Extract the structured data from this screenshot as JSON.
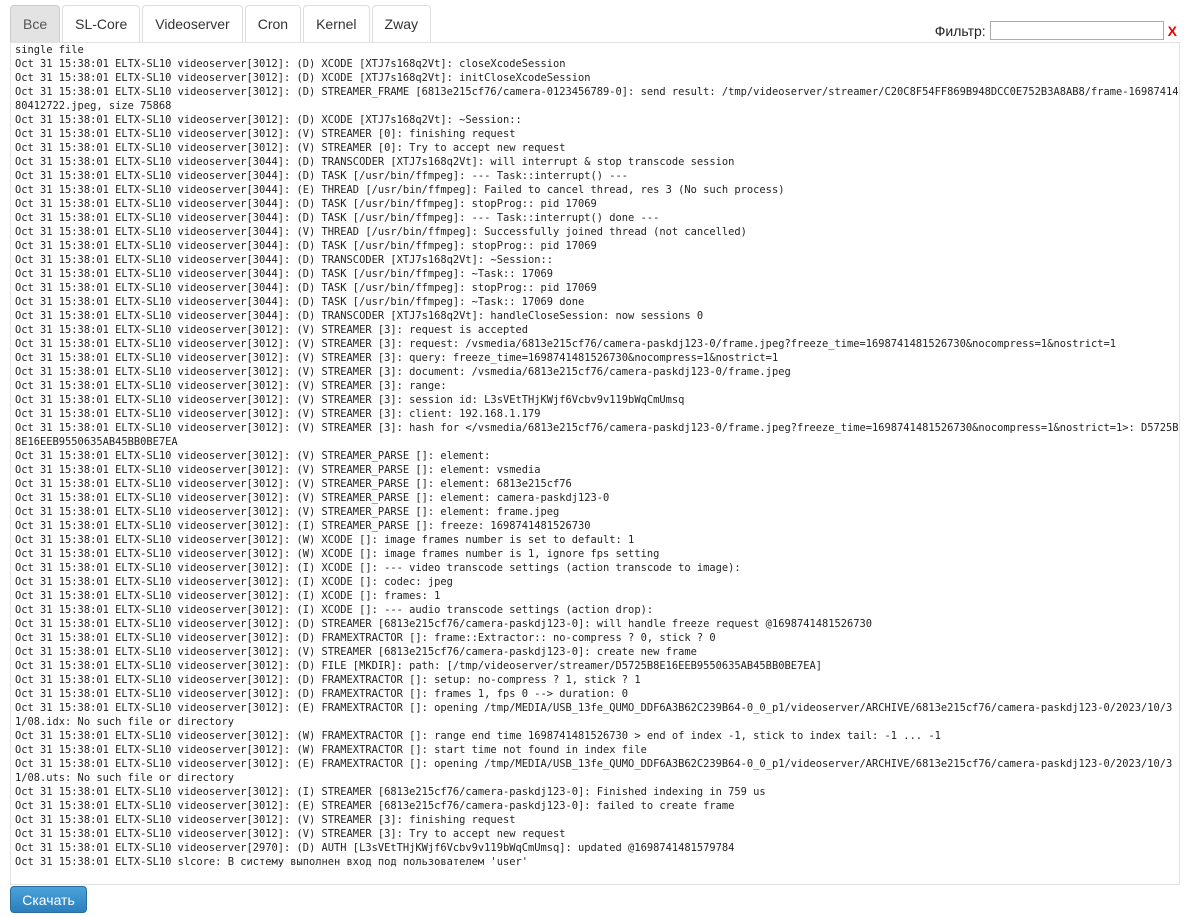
{
  "tabs": [
    {
      "label": "Все",
      "active": true
    },
    {
      "label": "SL-Core",
      "active": false
    },
    {
      "label": "Videoserver",
      "active": false
    },
    {
      "label": "Cron",
      "active": false
    },
    {
      "label": "Kernel",
      "active": false
    },
    {
      "label": "Zway",
      "active": false
    }
  ],
  "filter": {
    "label": "Фильтр:",
    "value": "",
    "clear_label": "X",
    "clear_color": "#ee0000"
  },
  "log": {
    "lines": [
      "single file",
      "Oct 31 15:38:01 ELTX-SL10 videoserver[3012]: (D) XCODE [XTJ7s168q2Vt]: closeXcodeSession",
      "Oct 31 15:38:01 ELTX-SL10 videoserver[3012]: (D) XCODE [XTJ7s168q2Vt]: initCloseXcodeSession",
      "Oct 31 15:38:01 ELTX-SL10 videoserver[3012]: (D) STREAMER_FRAME [6813e215cf76/camera-0123456789-0]: send result: /tmp/videoserver/streamer/C20C8F54FF869B948DCC0E752B3A8AB8/frame-1698741480412722.jpeg, size 75868",
      "Oct 31 15:38:01 ELTX-SL10 videoserver[3012]: (D) XCODE [XTJ7s168q2Vt]: ~Session::",
      "Oct 31 15:38:01 ELTX-SL10 videoserver[3012]: (V) STREAMER [0]: finishing request",
      "Oct 31 15:38:01 ELTX-SL10 videoserver[3012]: (V) STREAMER [0]: Try to accept new request",
      "Oct 31 15:38:01 ELTX-SL10 videoserver[3044]: (D) TRANSCODER [XTJ7s168q2Vt]: will interrupt & stop transcode session",
      "Oct 31 15:38:01 ELTX-SL10 videoserver[3044]: (D) TASK [/usr/bin/ffmpeg]: --- Task::interrupt() ---",
      "Oct 31 15:38:01 ELTX-SL10 videoserver[3044]: (E) THREAD [/usr/bin/ffmpeg]: Failed to cancel thread, res 3 (No such process)",
      "Oct 31 15:38:01 ELTX-SL10 videoserver[3044]: (D) TASK [/usr/bin/ffmpeg]: stopProg:: pid 17069",
      "Oct 31 15:38:01 ELTX-SL10 videoserver[3044]: (D) TASK [/usr/bin/ffmpeg]: --- Task::interrupt() done ---",
      "Oct 31 15:38:01 ELTX-SL10 videoserver[3044]: (V) THREAD [/usr/bin/ffmpeg]: Successfully joined thread (not cancelled)",
      "Oct 31 15:38:01 ELTX-SL10 videoserver[3044]: (D) TASK [/usr/bin/ffmpeg]: stopProg:: pid 17069",
      "Oct 31 15:38:01 ELTX-SL10 videoserver[3044]: (D) TRANSCODER [XTJ7s168q2Vt]: ~Session::",
      "Oct 31 15:38:01 ELTX-SL10 videoserver[3044]: (D) TASK [/usr/bin/ffmpeg]: ~Task:: 17069",
      "Oct 31 15:38:01 ELTX-SL10 videoserver[3044]: (D) TASK [/usr/bin/ffmpeg]: stopProg:: pid 17069",
      "Oct 31 15:38:01 ELTX-SL10 videoserver[3044]: (D) TASK [/usr/bin/ffmpeg]: ~Task:: 17069 done",
      "Oct 31 15:38:01 ELTX-SL10 videoserver[3044]: (D) TRANSCODER [XTJ7s168q2Vt]: handleCloseSession: now sessions 0",
      "Oct 31 15:38:01 ELTX-SL10 videoserver[3012]: (V) STREAMER [3]: request is accepted",
      "Oct 31 15:38:01 ELTX-SL10 videoserver[3012]: (V) STREAMER [3]: request: /vsmedia/6813e215cf76/camera-paskdj123-0/frame.jpeg?freeze_time=1698741481526730&nocompress=1&nostrict=1",
      "Oct 31 15:38:01 ELTX-SL10 videoserver[3012]: (V) STREAMER [3]: query: freeze_time=1698741481526730&nocompress=1&nostrict=1",
      "Oct 31 15:38:01 ELTX-SL10 videoserver[3012]: (V) STREAMER [3]: document: /vsmedia/6813e215cf76/camera-paskdj123-0/frame.jpeg",
      "Oct 31 15:38:01 ELTX-SL10 videoserver[3012]: (V) STREAMER [3]: range:",
      "Oct 31 15:38:01 ELTX-SL10 videoserver[3012]: (V) STREAMER [3]: session id: L3sVEtTHjKWjf6Vcbv9v119bWqCmUmsq",
      "Oct 31 15:38:01 ELTX-SL10 videoserver[3012]: (V) STREAMER [3]: client: 192.168.1.179",
      "Oct 31 15:38:01 ELTX-SL10 videoserver[3012]: (V) STREAMER [3]: hash for </vsmedia/6813e215cf76/camera-paskdj123-0/frame.jpeg?freeze_time=1698741481526730&nocompress=1&nostrict=1>: D5725B8E16EEB9550635AB45BB0BE7EA",
      "Oct 31 15:38:01 ELTX-SL10 videoserver[3012]: (V) STREAMER_PARSE []: element:",
      "Oct 31 15:38:01 ELTX-SL10 videoserver[3012]: (V) STREAMER_PARSE []: element: vsmedia",
      "Oct 31 15:38:01 ELTX-SL10 videoserver[3012]: (V) STREAMER_PARSE []: element: 6813e215cf76",
      "Oct 31 15:38:01 ELTX-SL10 videoserver[3012]: (V) STREAMER_PARSE []: element: camera-paskdj123-0",
      "Oct 31 15:38:01 ELTX-SL10 videoserver[3012]: (V) STREAMER_PARSE []: element: frame.jpeg",
      "Oct 31 15:38:01 ELTX-SL10 videoserver[3012]: (I) STREAMER_PARSE []: freeze: 1698741481526730",
      "Oct 31 15:38:01 ELTX-SL10 videoserver[3012]: (W) XCODE []: image frames number is set to default: 1",
      "Oct 31 15:38:01 ELTX-SL10 videoserver[3012]: (W) XCODE []: image frames number is 1, ignore fps setting",
      "Oct 31 15:38:01 ELTX-SL10 videoserver[3012]: (I) XCODE []: --- video transcode settings (action transcode to image):",
      "Oct 31 15:38:01 ELTX-SL10 videoserver[3012]: (I) XCODE []: codec: jpeg",
      "Oct 31 15:38:01 ELTX-SL10 videoserver[3012]: (I) XCODE []: frames: 1",
      "Oct 31 15:38:01 ELTX-SL10 videoserver[3012]: (I) XCODE []: --- audio transcode settings (action drop):",
      "Oct 31 15:38:01 ELTX-SL10 videoserver[3012]: (D) STREAMER [6813e215cf76/camera-paskdj123-0]: will handle freeze request @1698741481526730",
      "Oct 31 15:38:01 ELTX-SL10 videoserver[3012]: (D) FRAMEXTRACTOR []: frame::Extractor:: no-compress ? 0, stick ? 0",
      "Oct 31 15:38:01 ELTX-SL10 videoserver[3012]: (V) STREAMER [6813e215cf76/camera-paskdj123-0]: create new frame",
      "Oct 31 15:38:01 ELTX-SL10 videoserver[3012]: (D) FILE [MKDIR]: path: [/tmp/videoserver/streamer/D5725B8E16EEB9550635AB45BB0BE7EA]",
      "Oct 31 15:38:01 ELTX-SL10 videoserver[3012]: (D) FRAMEXTRACTOR []: setup: no-compress ? 1, stick ? 1",
      "Oct 31 15:38:01 ELTX-SL10 videoserver[3012]: (D) FRAMEXTRACTOR []: frames 1, fps 0 --> duration: 0",
      "Oct 31 15:38:01 ELTX-SL10 videoserver[3012]: (E) FRAMEXTRACTOR []: opening /tmp/MEDIA/USB_13fe_QUMO_DDF6A3B62C239B64-0_0_p1/videoserver/ARCHIVE/6813e215cf76/camera-paskdj123-0/2023/10/31/08.idx: No such file or directory",
      "Oct 31 15:38:01 ELTX-SL10 videoserver[3012]: (W) FRAMEXTRACTOR []: range end time 1698741481526730 > end of index -1, stick to index tail: -1 ... -1",
      "Oct 31 15:38:01 ELTX-SL10 videoserver[3012]: (W) FRAMEXTRACTOR []: start time not found in index file",
      "Oct 31 15:38:01 ELTX-SL10 videoserver[3012]: (E) FRAMEXTRACTOR []: opening /tmp/MEDIA/USB_13fe_QUMO_DDF6A3B62C239B64-0_0_p1/videoserver/ARCHIVE/6813e215cf76/camera-paskdj123-0/2023/10/31/08.uts: No such file or directory",
      "Oct 31 15:38:01 ELTX-SL10 videoserver[3012]: (I) STREAMER [6813e215cf76/camera-paskdj123-0]: Finished indexing in 759 us",
      "Oct 31 15:38:01 ELTX-SL10 videoserver[3012]: (E) STREAMER [6813e215cf76/camera-paskdj123-0]: failed to create frame",
      "Oct 31 15:38:01 ELTX-SL10 videoserver[3012]: (V) STREAMER [3]: finishing request",
      "Oct 31 15:38:01 ELTX-SL10 videoserver[3012]: (V) STREAMER [3]: Try to accept new request",
      "Oct 31 15:38:01 ELTX-SL10 videoserver[2970]: (D) AUTH [L3sVEtTHjKWjf6Vcbv9v119bWqCmUmsq]: updated @1698741481579784",
      "Oct 31 15:38:01 ELTX-SL10 slcore: В систему выполнен вход под пользователем 'user'"
    ]
  },
  "download_label": "Скачать"
}
